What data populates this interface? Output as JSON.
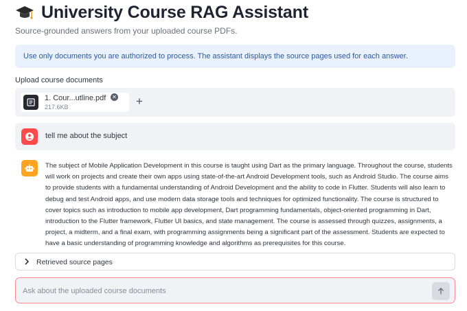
{
  "header": {
    "title": "University Course RAG Assistant",
    "icon": "graduation-cap-icon",
    "subtitle": "Source-grounded answers from your uploaded course PDFs."
  },
  "info_banner": {
    "text": "Use only documents you are authorized to process. The assistant displays the source pages used for each answer.",
    "color": "#e8f1fc"
  },
  "uploader": {
    "label": "Upload course documents",
    "files": [
      {
        "name": "1. Cour...utline.pdf",
        "size": "217.6KB",
        "icon": "document-icon"
      }
    ],
    "add_icon": "plus-icon"
  },
  "messages": [
    {
      "role": "user",
      "avatar_icon": "user-icon",
      "avatar_color": "#ff4b4b",
      "text": "tell me about the subject"
    },
    {
      "role": "assistant",
      "avatar_icon": "robot-icon",
      "avatar_color": "#ffa421",
      "text": "The subject of Mobile Application Development in this course is taught using Dart as the primary language. Throughout the course, students will work on projects and create their own apps using state-of-the-art Android Development tools, such as Android Studio. The course aims to provide students with a fundamental understanding of Android Development and the ability to code in Flutter. Students will also learn to debug and test Android apps, and use modern data storage tools and techniques for optimized functionality. The course is structured to cover topics such as introduction to mobile app development, Dart programming fundamentals, object-oriented programming in Dart, introduction to the Flutter framework, Flutter UI basics, and state management. The course is assessed through quizzes, assignments, a project, a midterm, and a final exam, with programming assignments being a significant part of the assessment. Students are expected to have a basic understanding of programming knowledge and algorithms as prerequisites for this course."
    }
  ],
  "sources_expander": {
    "label": "Retrieved source pages",
    "icon": "chevron-right-icon"
  },
  "chat_input": {
    "placeholder": "Ask about the uploaded course documents",
    "value": "",
    "send_icon": "arrow-up-icon",
    "border_color": "#ff8a8a"
  }
}
